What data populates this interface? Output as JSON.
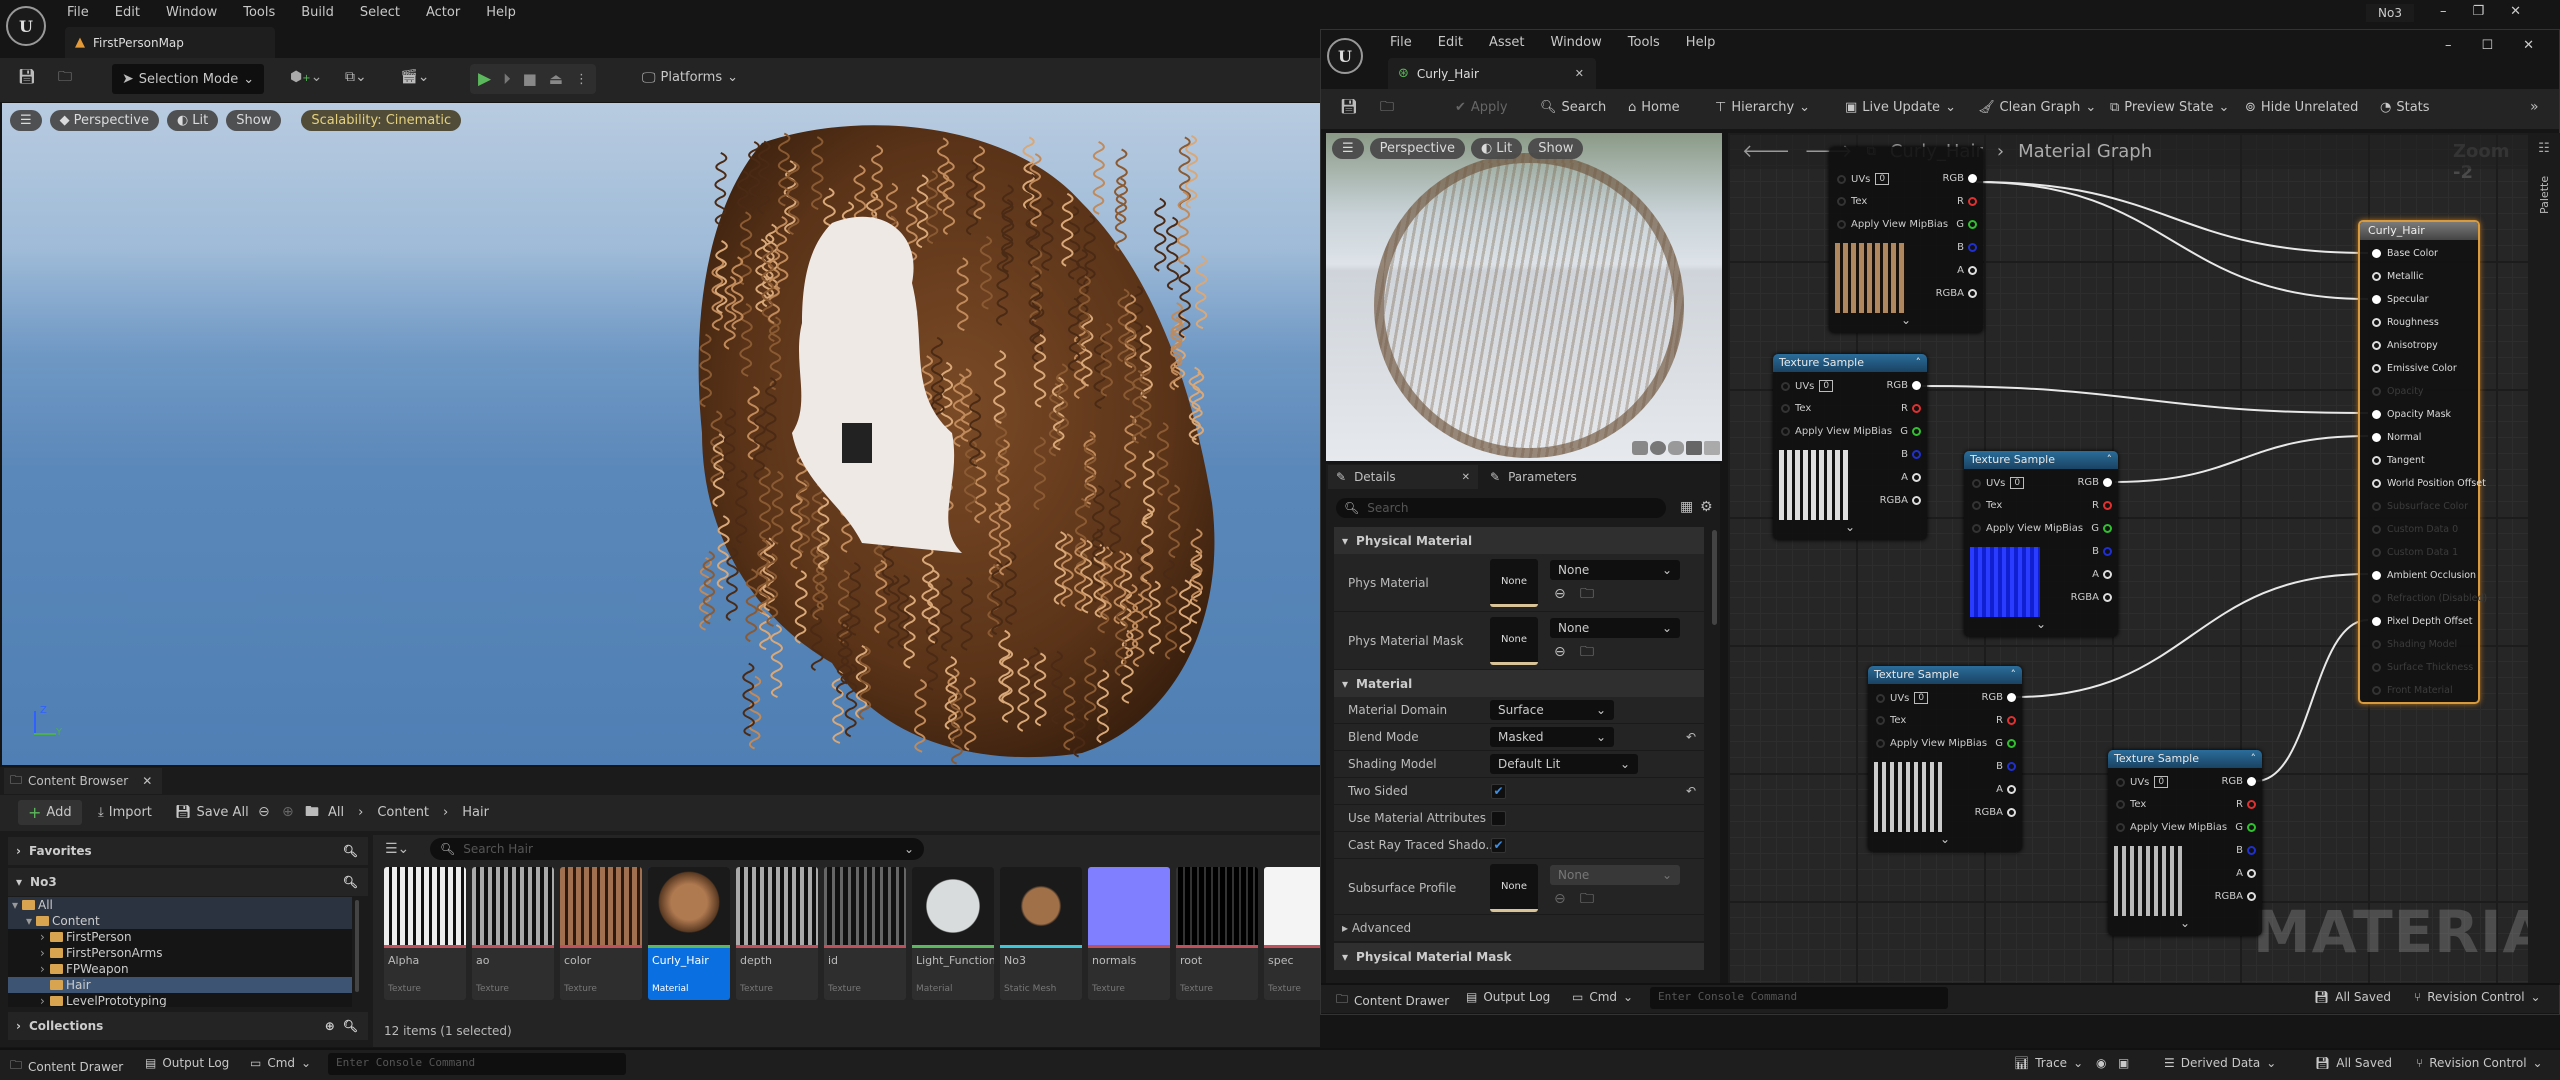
{
  "main_window": {
    "menu": [
      "File",
      "Edit",
      "Window",
      "Tools",
      "Build",
      "Select",
      "Actor",
      "Help"
    ],
    "project_name": "No3",
    "level_tab": "FirstPersonMap",
    "toolbar": {
      "selection_mode": "Selection Mode",
      "platforms": "Platforms"
    },
    "viewport": {
      "perspective": "Perspective",
      "lit": "Lit",
      "show": "Show",
      "scalability": "Scalability: Cinematic",
      "axis_y": "Y",
      "axis_z": "Z"
    }
  },
  "content_browser": {
    "tab": "Content Browser",
    "add": "Add",
    "import": "Import",
    "save_all": "Save All",
    "breadcrumb": [
      "All",
      "Content",
      "Hair"
    ],
    "favorites": "Favorites",
    "project": "No3",
    "tree": [
      {
        "label": "All",
        "level": 0
      },
      {
        "label": "Content",
        "level": 1
      },
      {
        "label": "FirstPerson",
        "level": 2
      },
      {
        "label": "FirstPersonArms",
        "level": 2
      },
      {
        "label": "FPWeapon",
        "level": 2
      },
      {
        "label": "Hair",
        "level": 2,
        "selected": true
      },
      {
        "label": "LevelPrototyping",
        "level": 2
      }
    ],
    "collections": "Collections",
    "search_placeholder": "Search Hair",
    "assets": [
      {
        "name": "Alpha",
        "type": "Texture",
        "color": "#c0505a",
        "thumb": "strands-white"
      },
      {
        "name": "ao",
        "type": "Texture",
        "color": "#c0505a",
        "thumb": "strands-grey"
      },
      {
        "name": "color",
        "type": "Texture",
        "color": "#c0505a",
        "thumb": "strands-brown"
      },
      {
        "name": "Curly_Hair",
        "type": "Material",
        "color": "#5cb85c",
        "thumb": "sphere-hair",
        "selected": true
      },
      {
        "name": "depth",
        "type": "Texture",
        "color": "#c0505a",
        "thumb": "strands-grey"
      },
      {
        "name": "id",
        "type": "Texture",
        "color": "#c0505a",
        "thumb": "strands-dark"
      },
      {
        "name": "Light_Function",
        "type": "Material",
        "color": "#5cb85c",
        "thumb": "sphere-white"
      },
      {
        "name": "No3",
        "type": "Static Mesh",
        "color": "#3ec6d8",
        "thumb": "hair-mesh"
      },
      {
        "name": "normals",
        "type": "Texture",
        "color": "#c0505a",
        "thumb": "normal"
      },
      {
        "name": "root",
        "type": "Texture",
        "color": "#c0505a",
        "thumb": "strands-black"
      },
      {
        "name": "spec",
        "type": "Texture",
        "color": "#c0505a",
        "thumb": "white"
      }
    ],
    "status": "12 items (1 selected)"
  },
  "status_bar": {
    "content_drawer": "Content Drawer",
    "output_log": "Output Log",
    "cmd": "Cmd",
    "console_placeholder": "Enter Console Command",
    "trace": "Trace",
    "derived_data": "Derived Data",
    "all_saved": "All Saved",
    "revision_control": "Revision Control"
  },
  "material_editor": {
    "menu": [
      "File",
      "Edit",
      "Asset",
      "Window",
      "Tools",
      "Help"
    ],
    "tab": "Curly_Hair",
    "toolbar": [
      "Apply",
      "Search",
      "Home",
      "Hierarchy",
      "Live Update",
      "Clean Graph",
      "Preview State",
      "Hide Unrelated",
      "Stats"
    ],
    "preview": {
      "perspective": "Perspective",
      "lit": "Lit",
      "show": "Show"
    },
    "details": {
      "tab_details": "Details",
      "tab_parameters": "Parameters",
      "search_placeholder": "Search",
      "sections": {
        "physical_material": "Physical Material",
        "material": "Material",
        "advanced": "Advanced",
        "physical_material_mask": "Physical Material Mask"
      },
      "phys_material": {
        "label": "Phys Material",
        "thumb": "None",
        "value": "None"
      },
      "phys_material_mask": {
        "label": "Phys Material Mask",
        "thumb": "None",
        "value": "None"
      },
      "material_domain": {
        "label": "Material Domain",
        "value": "Surface"
      },
      "blend_mode": {
        "label": "Blend Mode",
        "value": "Masked"
      },
      "shading_model": {
        "label": "Shading Model",
        "value": "Default Lit"
      },
      "two_sided": {
        "label": "Two Sided",
        "checked": true
      },
      "use_material_attributes": {
        "label": "Use Material Attributes",
        "checked": false
      },
      "cast_ray_traced_shadows": {
        "label": "Cast Ray Traced Shado...",
        "checked": true
      },
      "subsurface_profile": {
        "label": "Subsurface Profile",
        "thumb": "None",
        "value": "None"
      }
    },
    "graph": {
      "breadcrumb": [
        "Curly_Hair",
        "Material Graph"
      ],
      "zoom": "Zoom -2",
      "palette": "Palette",
      "watermark": "MATERIAL",
      "texture_node": {
        "title": "Texture Sample",
        "inputs": [
          "UVs",
          "Tex",
          "Apply View MipBias"
        ],
        "uv_value": "0",
        "outputs": [
          "RGB",
          "R",
          "G",
          "B",
          "A",
          "RGBA"
        ]
      },
      "result_node": {
        "title": "Curly_Hair",
        "pins": [
          {
            "label": "Base Color",
            "connected": true
          },
          {
            "label": "Metallic"
          },
          {
            "label": "Specular",
            "connected": true
          },
          {
            "label": "Roughness"
          },
          {
            "label": "Anisotropy"
          },
          {
            "label": "Emissive Color"
          },
          {
            "label": "Opacity",
            "disabled": true
          },
          {
            "label": "Opacity Mask",
            "connected": true
          },
          {
            "label": "Normal",
            "connected": true
          },
          {
            "label": "Tangent"
          },
          {
            "label": "World Position Offset"
          },
          {
            "label": "Subsurface Color",
            "disabled": true
          },
          {
            "label": "Custom Data 0",
            "disabled": true
          },
          {
            "label": "Custom Data 1",
            "disabled": true
          },
          {
            "label": "Ambient Occlusion",
            "connected": true
          },
          {
            "label": "Refraction (Disabled)",
            "disabled": true
          },
          {
            "label": "Pixel Depth Offset",
            "connected": true
          },
          {
            "label": "Shading Model",
            "disabled": true
          },
          {
            "label": "Surface Thickness",
            "disabled": true
          },
          {
            "label": "Front Material",
            "disabled": true
          }
        ]
      }
    }
  },
  "colors": {
    "accent": "#0a6fe0",
    "play": "#5cb85c",
    "result_border": "#d89a3a",
    "node_header": "#1f5a80"
  }
}
